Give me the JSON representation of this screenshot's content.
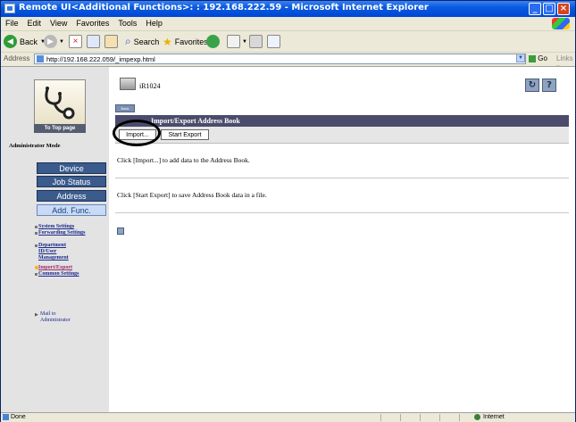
{
  "window": {
    "title": "Remote UI<Additional Functions>: : 192.168.222.59 - Microsoft Internet Explorer"
  },
  "menu": [
    "File",
    "Edit",
    "View",
    "Favorites",
    "Tools",
    "Help"
  ],
  "toolbar": {
    "back": "Back",
    "search": "Search",
    "favorites": "Favorites"
  },
  "address": {
    "label": "Address",
    "url": "http://192.168.222.059/_impexp.html",
    "go": "Go",
    "links": "Links"
  },
  "sidebar": {
    "to_top": "To Top page",
    "admin_mode": "Administrator Mode",
    "nav": [
      "Device",
      "Job Status",
      "Address",
      "Add. Func."
    ],
    "active_nav": "Add. Func.",
    "sub_items": [
      "System Settings",
      "Forwarding Settings",
      "Department ID/User Management",
      "Import/Export",
      "Common Settings"
    ],
    "current_sub": "Import/Export",
    "mail_to": "Mail to Administrator"
  },
  "main": {
    "device_name": "iR1024",
    "back_label": "Back",
    "section_title": "Import/Export Address Book",
    "import_button": "Import...",
    "export_button": "Start Export",
    "import_msg": "Click [Import...] to add data to the Address Book.",
    "export_msg": "Click [Start Export] to save Address Book data in a file."
  },
  "status": {
    "text": "Done",
    "zone": "Internet"
  },
  "colors": {
    "titlebar": "#0a5be0",
    "nav_button": "#3a5b8c",
    "nav_active": "#c9daf5",
    "header": "#4b4b6c"
  }
}
